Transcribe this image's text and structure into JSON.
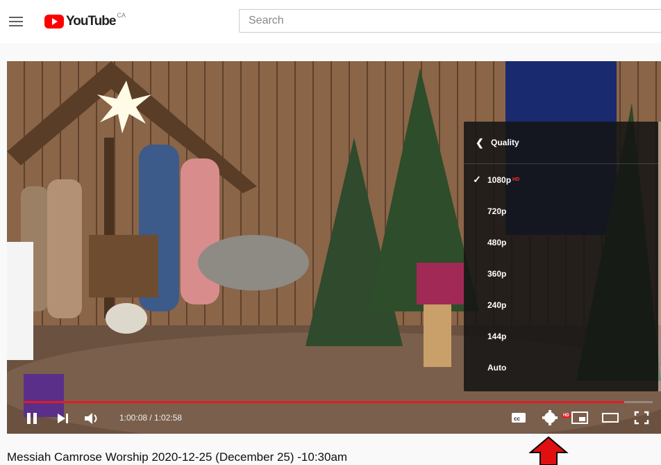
{
  "header": {
    "logo_text": "YouTube",
    "logo_country": "CA",
    "search_placeholder": "Search"
  },
  "player": {
    "quality_menu": {
      "title": "Quality",
      "options": [
        {
          "label": "1080p",
          "selected": true,
          "hd": true
        },
        {
          "label": "720p",
          "selected": false
        },
        {
          "label": "480p",
          "selected": false
        },
        {
          "label": "360p",
          "selected": false
        },
        {
          "label": "240p",
          "selected": false
        },
        {
          "label": "144p",
          "selected": false
        },
        {
          "label": "Auto",
          "selected": false
        }
      ]
    },
    "time_display": "1:00:08 / 1:02:58",
    "progress": 0.955,
    "settings_badge": "HD",
    "colors": {
      "progress": "#e31b23",
      "hd_badge": "#e31b23"
    }
  },
  "video": {
    "title": "Messiah Camrose Worship 2020-12-25 (December 25) -10:30am"
  },
  "icons": [
    "hamburger-icon",
    "youtube-logo-icon",
    "pause-icon",
    "next-icon",
    "volume-icon",
    "subtitles-icon",
    "settings-gear-icon",
    "miniplayer-icon",
    "theater-icon",
    "fullscreen-icon",
    "back-chevron-icon",
    "check-icon",
    "red-arrow-icon"
  ]
}
